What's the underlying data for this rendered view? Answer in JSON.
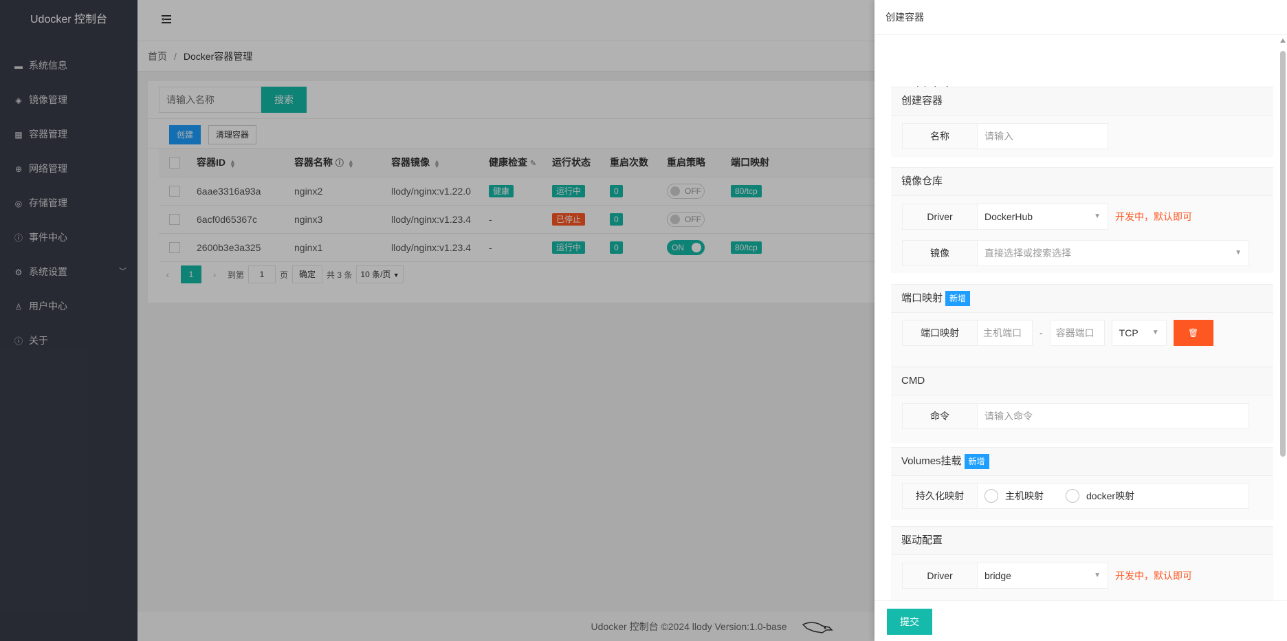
{
  "sidebar": {
    "title": "Udocker 控制台",
    "items": [
      {
        "label": "系统信息",
        "icon": "server-icon"
      },
      {
        "label": "镜像管理",
        "icon": "layers-icon"
      },
      {
        "label": "容器管理",
        "icon": "container-icon"
      },
      {
        "label": "网络管理",
        "icon": "globe-icon"
      },
      {
        "label": "存储管理",
        "icon": "storage-icon"
      },
      {
        "label": "事件中心",
        "icon": "info-icon"
      },
      {
        "label": "系统设置",
        "icon": "gear-icon",
        "has_submenu": true
      },
      {
        "label": "用户中心",
        "icon": "user-icon"
      },
      {
        "label": "关于",
        "icon": "info-icon"
      }
    ]
  },
  "breadcrumb": {
    "home": "首页",
    "separator": "/",
    "current": "Docker容器管理"
  },
  "search": {
    "placeholder": "请输入名称",
    "button": "搜索"
  },
  "toolbar": {
    "create": "创建",
    "clean": "清理容器"
  },
  "table": {
    "columns": [
      "容器ID",
      "容器名称",
      "容器镜像",
      "健康检查",
      "运行状态",
      "重启次数",
      "重启策略",
      "端口映射"
    ],
    "rows": [
      {
        "id": "6aae3316a93a",
        "name": "nginx2",
        "image": "llody/nginx:v1.22.0",
        "health": "健康",
        "status": "运行中",
        "restarts": "0",
        "policy": "OFF",
        "ports": "80/tcp"
      },
      {
        "id": "6acf0d65367c",
        "name": "nginx3",
        "image": "llody/nginx:v1.23.4",
        "health": "-",
        "status": "已停止",
        "restarts": "0",
        "policy": "OFF",
        "ports": ""
      },
      {
        "id": "2600b3e3a325",
        "name": "nginx1",
        "image": "llody/nginx:v1.23.4",
        "health": "-",
        "status": "运行中",
        "restarts": "0",
        "policy": "ON",
        "ports": "80/tcp"
      }
    ]
  },
  "pager": {
    "current": "1",
    "goto": "到第",
    "page_input": "1",
    "page_unit": "页",
    "confirm": "确定",
    "total": "共 3 条",
    "per_page": "10 条/页"
  },
  "footer": {
    "text": "Udocker 控制台 ©2024 llody Version:1.0-base"
  },
  "drawer": {
    "title": "创建容器",
    "legend": "创建容器",
    "sections": {
      "basic": {
        "title": "创建容器",
        "name_label": "名称",
        "name_placeholder": "请输入"
      },
      "registry": {
        "title": "镜像仓库",
        "driver_label": "Driver",
        "driver_value": "DockerHub",
        "driver_hint": "开发中，默认即可",
        "image_label": "镜像",
        "image_placeholder": "直接选择或搜索选择"
      },
      "ports": {
        "title": "端口映射",
        "new": "新增",
        "label": "端口映射",
        "host_placeholder": "主机端口",
        "dash": "-",
        "container_placeholder": "容器端口",
        "protocol": "TCP"
      },
      "cmd": {
        "title": "CMD",
        "label": "命令",
        "placeholder": "请输入命令"
      },
      "volumes": {
        "title": "Volumes挂载",
        "new": "新增",
        "label": "持久化映射",
        "option1": "主机映射",
        "option2": "docker映射"
      },
      "network": {
        "title": "驱动配置",
        "driver_label": "Driver",
        "driver_value": "bridge",
        "driver_hint": "开发中，默认即可"
      }
    },
    "submit": "提交"
  },
  "colors": {
    "sidebar_bg": "#393d49",
    "accent_teal": "#16baaa",
    "accent_blue": "#1e9fff",
    "danger": "#ff5722"
  }
}
